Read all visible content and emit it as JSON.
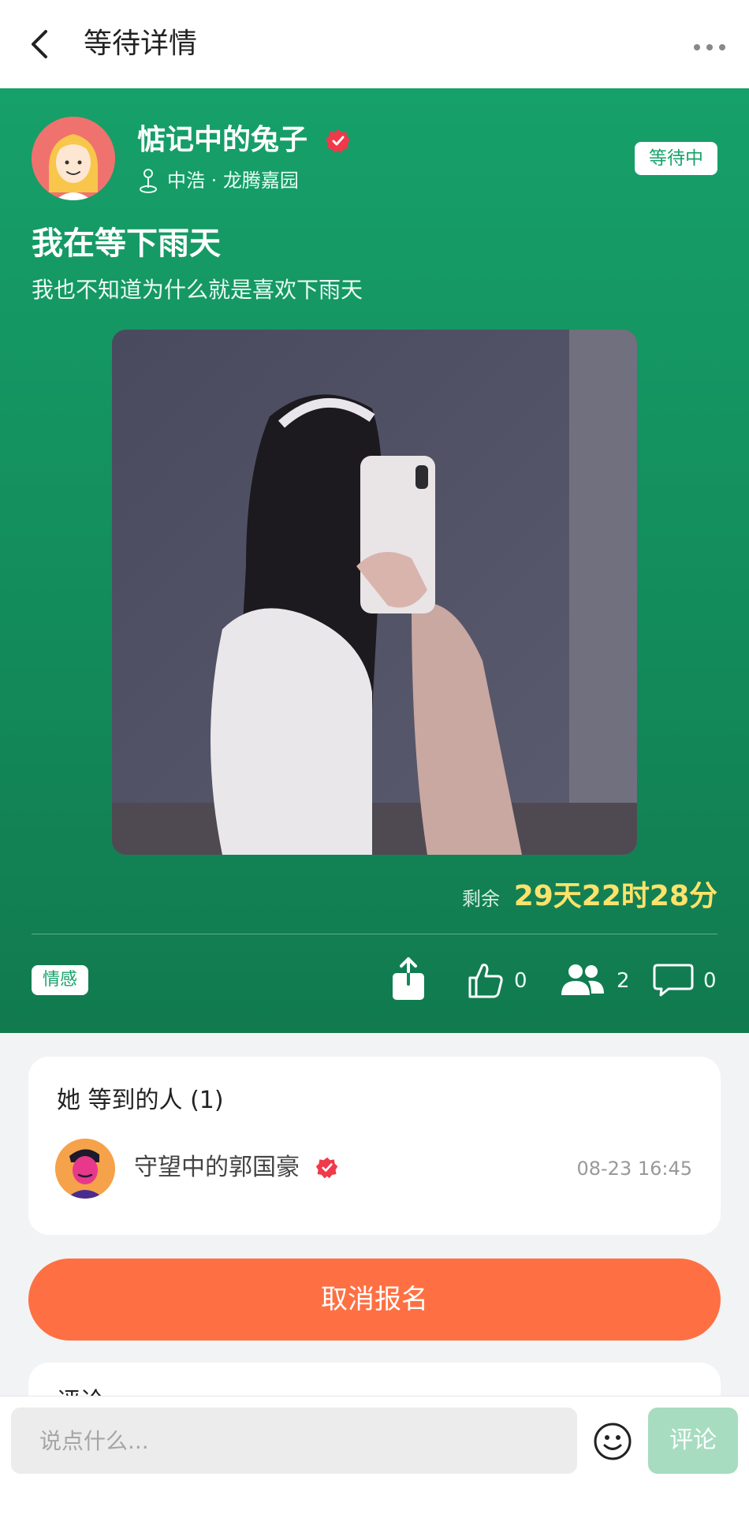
{
  "header": {
    "title": "等待详情",
    "back_icon": "chevron-left-icon",
    "more_icon": "more-dots-icon"
  },
  "post": {
    "user_name": "惦记中的兔子",
    "location": "中浩 · 龙腾嘉园",
    "status": "等待中",
    "title": "我在等下雨天",
    "description": "我也不知道为什么就是喜欢下雨天",
    "remaining_label": "剩余",
    "remaining_value": "29天22时28分",
    "tag": "情感",
    "like_count": "0",
    "people_count": "2",
    "comment_count": "0"
  },
  "waited": {
    "title": "她 等到的人 (1)",
    "items": [
      {
        "name": "守望中的郭国豪",
        "time": "08-23 16:45"
      }
    ]
  },
  "actions": {
    "cancel_label": "取消报名"
  },
  "next_section": {
    "title": "评论"
  },
  "comment_bar": {
    "placeholder": "说点什么...",
    "submit_label": "评论"
  },
  "colors": {
    "brand_green": "#17a36b",
    "accent_orange": "#fe7043",
    "countdown_yellow": "#ffe26b",
    "verified_red": "#f0394a"
  }
}
